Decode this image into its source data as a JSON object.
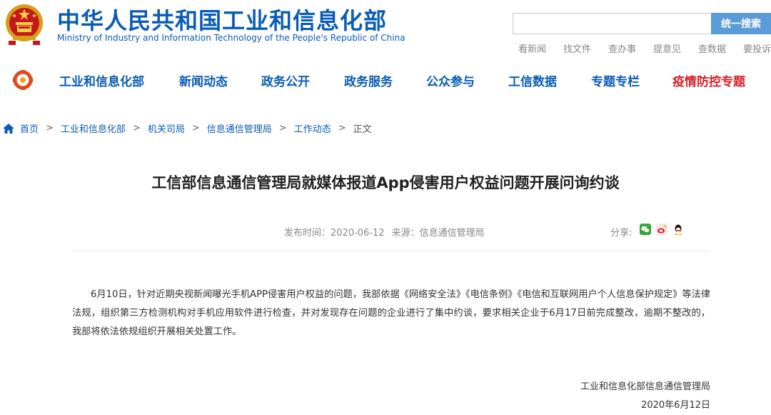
{
  "header": {
    "title": "中华人民共和国工业和信息化部",
    "subtitle": "Ministry of Industry and Information Technology of the People's Republic of China",
    "search": {
      "placeholder": "",
      "button_label": "统一搜索"
    },
    "quick_links": [
      "看新闻",
      "找文件",
      "查办事",
      "提意见",
      "查数据",
      "要投诉"
    ]
  },
  "nav": {
    "items": [
      {
        "label": "工业和信息化部"
      },
      {
        "label": "新闻动态"
      },
      {
        "label": "政务公开"
      },
      {
        "label": "政务服务"
      },
      {
        "label": "公众参与"
      },
      {
        "label": "工信数据"
      },
      {
        "label": "专题专栏"
      },
      {
        "label": "疫情防控专题"
      }
    ],
    "highlight_color": "#d8202a"
  },
  "breadcrumb": [
    "首页",
    "工业和信息化部",
    "机关司局",
    "信息通信管理局",
    "工作动态",
    "正文"
  ],
  "article": {
    "title": "工信部信息通信管理局就媒体报道App侵害用户权益问题开展问询约谈",
    "publish_label": "发布时间：",
    "publish_date": "2020-06-12",
    "source_label": "来源：",
    "source": "信息通信管理局",
    "share_label": "分享:",
    "share_icons": [
      "wechat-icon",
      "weibo-icon",
      "qq-icon"
    ],
    "body": "6月10日，针对近期央视新闻曝光手机APP侵害用户权益的问题，我部依据《网络安全法》《电信条例》《电信和互联网用户个人信息保护规定》等法律法规，组织第三方检测机构对手机应用软件进行检查，并对发现存在问题的企业进行了集中约谈，要求相关企业于6月17日前完成整改，逾期不整改的，我部将依法依规组织开展相关处置工作。",
    "signature_org": "工业和信息化部信息通信管理局",
    "signature_date": "2020年6月12日"
  },
  "colors": {
    "brand_blue": "#0a5cb6",
    "search_button": "#5b9bd8"
  }
}
